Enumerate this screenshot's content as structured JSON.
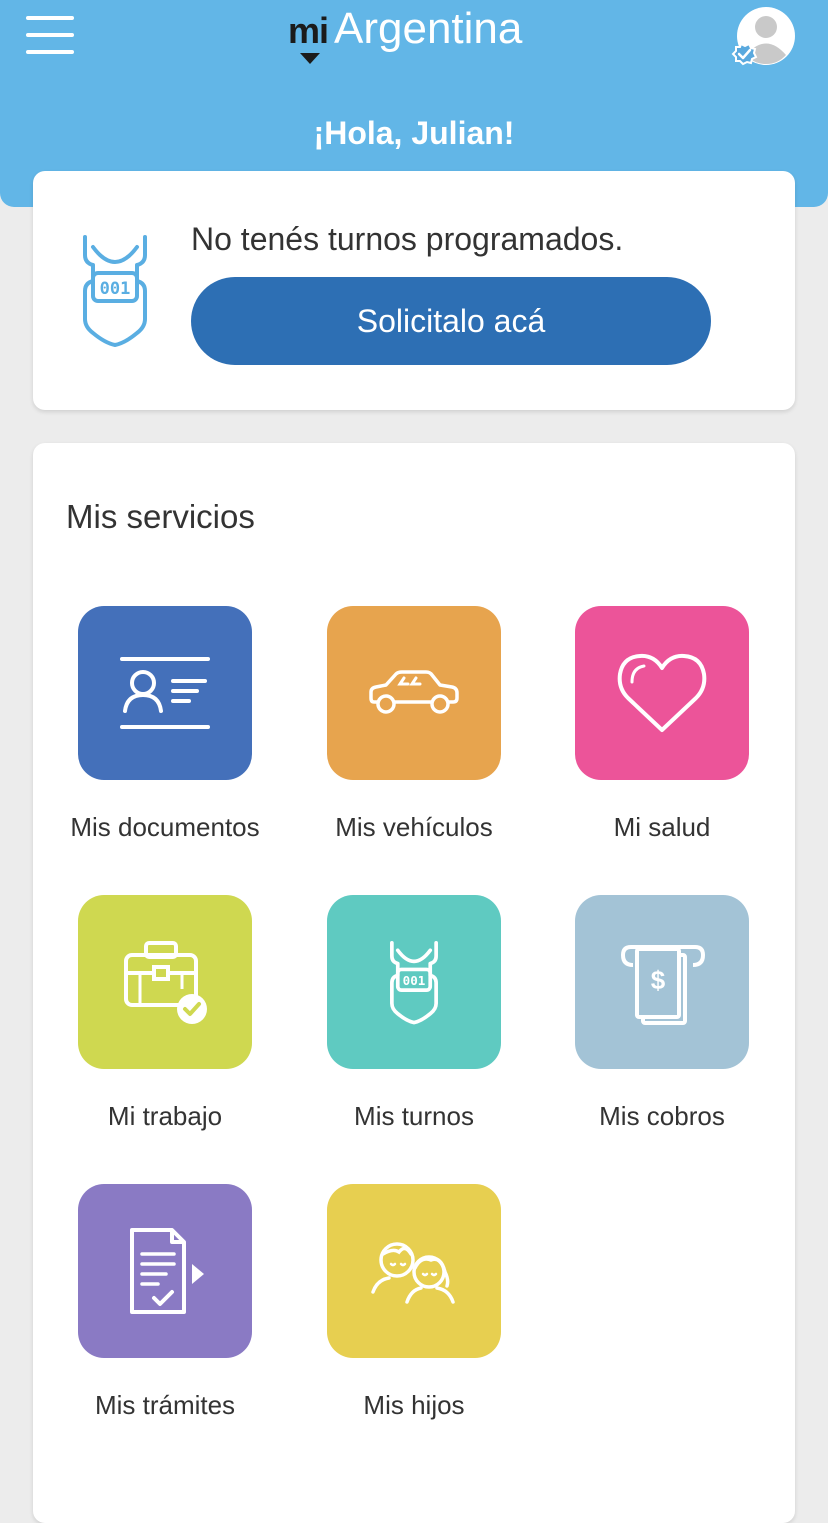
{
  "header": {
    "logo_prefix": "mi",
    "logo_name": "Argentina",
    "greeting": "¡Hola, Julian!",
    "background_color": "#62b6e7"
  },
  "turnos": {
    "message": "No tenés turnos programados.",
    "button_label": "Solicitalo acá",
    "button_color": "#2d6fb4"
  },
  "services": {
    "title": "Mis servicios",
    "items": [
      {
        "label": "Mis documentos",
        "icon": "id-card-icon",
        "color": "#4470ba"
      },
      {
        "label": "Mis vehículos",
        "icon": "car-icon",
        "color": "#e7a44e"
      },
      {
        "label": "Mi salud",
        "icon": "heart-icon",
        "color": "#ec5499"
      },
      {
        "label": "Mi trabajo",
        "icon": "briefcase-icon",
        "color": "#cfd850"
      },
      {
        "label": "Mis turnos",
        "icon": "ticket-icon",
        "color": "#5fcac1"
      },
      {
        "label": "Mis cobros",
        "icon": "payment-icon",
        "color": "#a3c3d6"
      },
      {
        "label": "Mis trámites",
        "icon": "document-icon",
        "color": "#8a7ac4"
      },
      {
        "label": "Mis hijos",
        "icon": "children-icon",
        "color": "#e7cf50"
      }
    ]
  }
}
